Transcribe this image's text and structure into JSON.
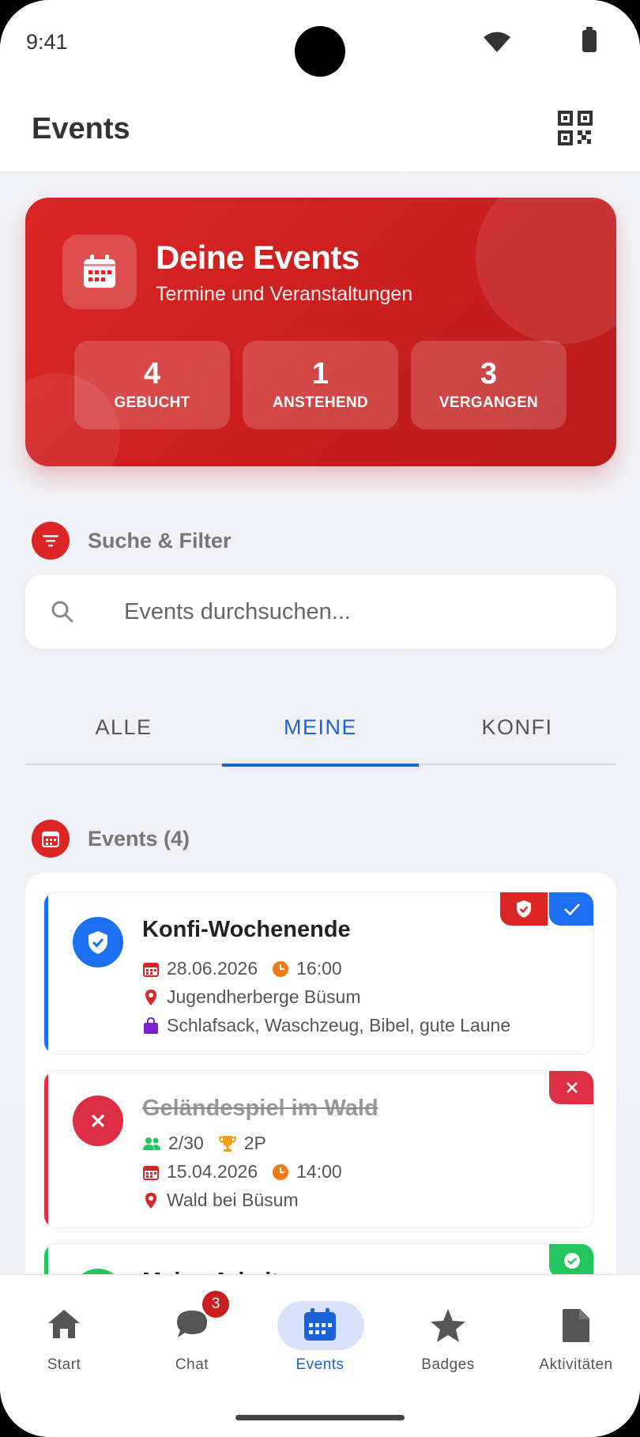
{
  "status_bar": {
    "time": "9:41"
  },
  "header": {
    "title": "Events",
    "qr_icon": "qr-code-icon"
  },
  "hero": {
    "title": "Deine Events",
    "subtitle": "Termine und Veranstaltungen",
    "accent_color": "#dc2626",
    "stats": [
      {
        "value": "4",
        "label": "GEBUCHT"
      },
      {
        "value": "1",
        "label": "ANSTEHEND"
      },
      {
        "value": "3",
        "label": "VERGANGEN"
      }
    ]
  },
  "filter_section": {
    "title": "Suche & Filter",
    "icon": "filter-icon"
  },
  "search": {
    "placeholder": "Events durchsuchen...",
    "value": ""
  },
  "tabs": [
    {
      "label": "ALLE",
      "active": false
    },
    {
      "label": "MEINE",
      "active": true
    },
    {
      "label": "KONFI",
      "active": false
    }
  ],
  "events_section": {
    "title": "Events (4)",
    "icon": "calendar-icon"
  },
  "events": [
    {
      "title": "Konfi-Wochenende",
      "date": "28.06.2026",
      "time": "16:00",
      "location": "Jugendherberge Büsum",
      "packing": "Schlafsack, Waschzeug, Bibel, gute Laune",
      "status_color": "#1d6ff2",
      "status_icon": "shield-check-icon"
    },
    {
      "title": "Geländespiel im Wald",
      "participants": "2/30",
      "points": "2P",
      "date": "15.04.2026",
      "time": "14:00",
      "location": "Wald bei Büsum",
      "status_color": "#dc2f45",
      "status_icon": "close-icon"
    },
    {
      "title": "Meine Arbeit",
      "status_color": "#22c55e",
      "status_icon": "check-circle-icon"
    }
  ],
  "bottom_nav": [
    {
      "label": "Start",
      "icon": "home-icon",
      "active": false
    },
    {
      "label": "Chat",
      "icon": "chat-icon",
      "active": false,
      "badge": "3"
    },
    {
      "label": "Events",
      "icon": "calendar-icon",
      "active": true
    },
    {
      "label": "Badges",
      "icon": "star-icon",
      "active": false
    },
    {
      "label": "Aktivitäten",
      "icon": "document-icon",
      "active": false
    }
  ]
}
